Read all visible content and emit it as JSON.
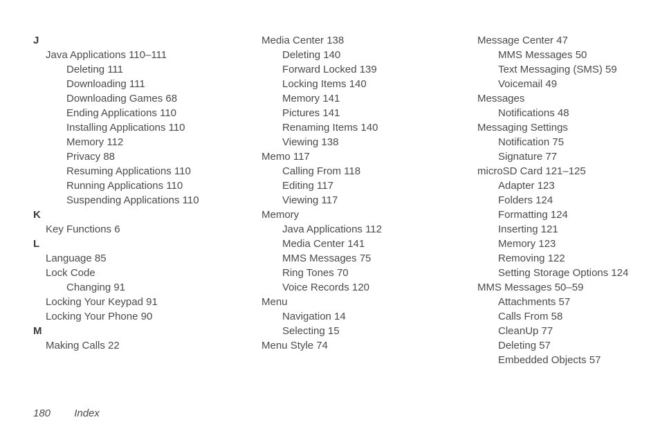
{
  "footer": {
    "page": "180",
    "title": "Index"
  },
  "columns": [
    [
      {
        "type": "letter",
        "text": "J"
      },
      {
        "type": "entry",
        "text": "Java Applications 110–111"
      },
      {
        "type": "sub",
        "text": "Deleting 111"
      },
      {
        "type": "sub",
        "text": "Downloading 111"
      },
      {
        "type": "sub",
        "text": "Downloading Games 68"
      },
      {
        "type": "sub",
        "text": "Ending Applications 110"
      },
      {
        "type": "sub",
        "text": "Installing Applications 110"
      },
      {
        "type": "sub",
        "text": "Memory 112"
      },
      {
        "type": "sub",
        "text": "Privacy 88"
      },
      {
        "type": "sub",
        "text": "Resuming Applications 110"
      },
      {
        "type": "sub",
        "text": "Running Applications 110"
      },
      {
        "type": "sub",
        "text": "Suspending Applications 110"
      },
      {
        "type": "letter",
        "text": "K"
      },
      {
        "type": "entry",
        "text": "Key Functions 6"
      },
      {
        "type": "letter",
        "text": "L"
      },
      {
        "type": "entry",
        "text": "Language 85"
      },
      {
        "type": "entry",
        "text": "Lock Code"
      },
      {
        "type": "sub",
        "text": "Changing 91"
      },
      {
        "type": "entry",
        "text": "Locking Your Keypad 91"
      },
      {
        "type": "entry",
        "text": "Locking Your Phone 90"
      },
      {
        "type": "letter",
        "text": "M"
      },
      {
        "type": "entry",
        "text": "Making Calls 22"
      }
    ],
    [
      {
        "type": "entry",
        "text": "Media Center 138"
      },
      {
        "type": "sub",
        "text": "Deleting 140"
      },
      {
        "type": "sub",
        "text": "Forward Locked 139"
      },
      {
        "type": "sub",
        "text": "Locking Items 140"
      },
      {
        "type": "sub",
        "text": "Memory 141"
      },
      {
        "type": "sub",
        "text": "Pictures 141"
      },
      {
        "type": "sub",
        "text": "Renaming Items 140"
      },
      {
        "type": "sub",
        "text": "Viewing 138"
      },
      {
        "type": "entry",
        "text": "Memo 117"
      },
      {
        "type": "sub",
        "text": "Calling From 118"
      },
      {
        "type": "sub",
        "text": "Editing 117"
      },
      {
        "type": "sub",
        "text": "Viewing 117"
      },
      {
        "type": "entry",
        "text": "Memory"
      },
      {
        "type": "sub",
        "text": "Java Applications 112"
      },
      {
        "type": "sub",
        "text": "Media Center 141"
      },
      {
        "type": "sub",
        "text": "MMS Messages 75"
      },
      {
        "type": "sub",
        "text": "Ring Tones 70"
      },
      {
        "type": "sub",
        "text": "Voice Records 120"
      },
      {
        "type": "entry",
        "text": "Menu"
      },
      {
        "type": "sub",
        "text": "Navigation 14"
      },
      {
        "type": "sub",
        "text": "Selecting 15"
      },
      {
        "type": "entry",
        "text": "Menu Style 74"
      }
    ],
    [
      {
        "type": "entry",
        "text": "Message Center 47"
      },
      {
        "type": "sub",
        "text": "MMS Messages 50"
      },
      {
        "type": "sub",
        "text": "Text Messaging (SMS) 59"
      },
      {
        "type": "sub",
        "text": "Voicemail 49"
      },
      {
        "type": "entry",
        "text": "Messages"
      },
      {
        "type": "sub",
        "text": "Notifications 48"
      },
      {
        "type": "entry",
        "text": "Messaging Settings"
      },
      {
        "type": "sub",
        "text": "Notification 75"
      },
      {
        "type": "sub",
        "text": "Signature 77"
      },
      {
        "type": "entry",
        "text": "microSD Card 121–125"
      },
      {
        "type": "sub",
        "text": "Adapter 123"
      },
      {
        "type": "sub",
        "text": "Folders 124"
      },
      {
        "type": "sub",
        "text": "Formatting 124"
      },
      {
        "type": "sub",
        "text": "Inserting 121"
      },
      {
        "type": "sub",
        "text": "Memory 123"
      },
      {
        "type": "sub",
        "text": "Removing 122"
      },
      {
        "type": "sub",
        "text": "Setting Storage Options 124"
      },
      {
        "type": "entry",
        "text": "MMS Messages 50–59"
      },
      {
        "type": "sub",
        "text": "Attachments 57"
      },
      {
        "type": "sub",
        "text": "Calls From 58"
      },
      {
        "type": "sub",
        "text": "CleanUp 77"
      },
      {
        "type": "sub",
        "text": "Deleting 57"
      },
      {
        "type": "sub",
        "text": "Embedded Objects 57"
      }
    ]
  ]
}
